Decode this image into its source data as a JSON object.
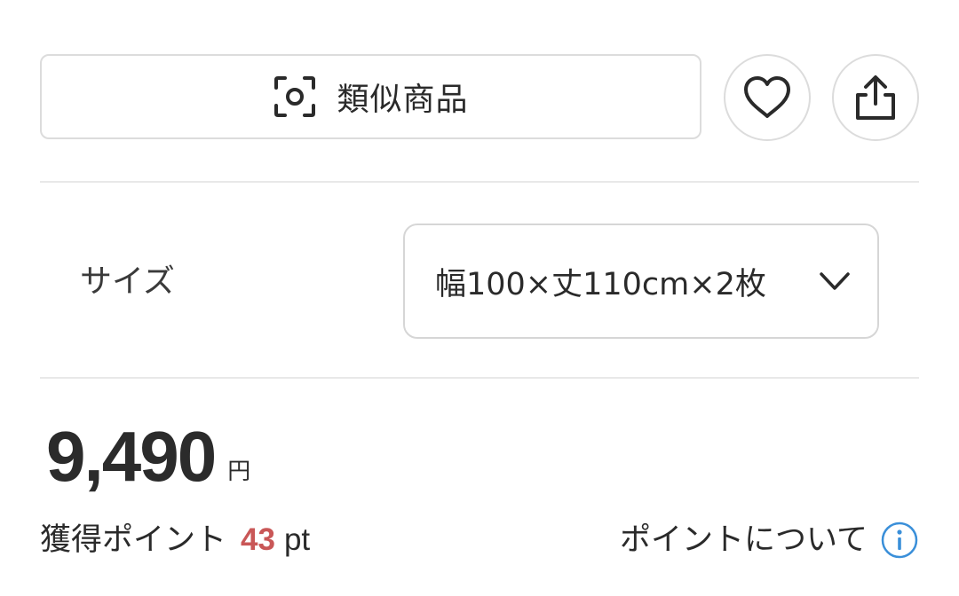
{
  "actions": {
    "similar_label": "類似商品",
    "similar_icon": "scan-icon",
    "favorite_icon": "heart-icon",
    "share_icon": "share-icon"
  },
  "size": {
    "label": "サイズ",
    "selected": "幅100×丈110cm×2枚",
    "chevron_icon": "chevron-down-icon"
  },
  "price": {
    "amount": "9,490",
    "currency": "円"
  },
  "points": {
    "label": "獲得ポイント",
    "value": "43",
    "unit": "pt",
    "about_label": "ポイントについて",
    "info_icon": "info-icon"
  },
  "colors": {
    "text": "#2a2a2a",
    "points_value": "#c95757",
    "info_blue": "#3a8fd9",
    "border": "#dcdcdc"
  }
}
